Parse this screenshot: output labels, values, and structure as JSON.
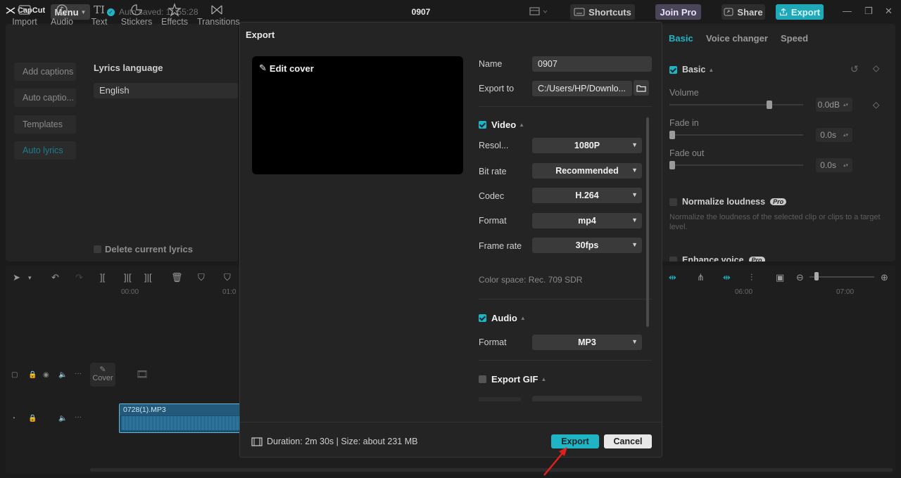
{
  "app": {
    "logo_text": "CapCut",
    "menu_label": "Menu",
    "autosave_text": "Auto saved: 11:55:28",
    "project_title": "0907",
    "shortcuts_label": "Shortcuts",
    "joinpro_label": "Join Pro",
    "share_label": "Share",
    "export_label": "Export"
  },
  "toolbar": {
    "items": [
      {
        "label": "Import",
        "icon": "import-icon"
      },
      {
        "label": "Audio",
        "icon": "audio-icon"
      },
      {
        "label": "Text",
        "icon": "text-icon"
      },
      {
        "label": "Stickers",
        "icon": "stickers-icon"
      },
      {
        "label": "Effects",
        "icon": "effects-icon"
      },
      {
        "label": "Transitions",
        "icon": "transitions-icon"
      }
    ]
  },
  "sidebar": {
    "items": [
      {
        "label": "Add captions"
      },
      {
        "label": "Auto captio..."
      },
      {
        "label": "Templates"
      },
      {
        "label": "Auto lyrics"
      }
    ]
  },
  "lyrics": {
    "heading": "Lyrics language",
    "language": "English",
    "delete_label": "Delete current lyrics"
  },
  "inspector": {
    "tabs": [
      {
        "label": "Basic"
      },
      {
        "label": "Voice changer"
      },
      {
        "label": "Speed"
      }
    ],
    "basic_label": "Basic",
    "volume_label": "Volume",
    "volume_value": "0.0dB",
    "fadein_label": "Fade in",
    "fadein_value": "0.0s",
    "fadeout_label": "Fade out",
    "fadeout_value": "0.0s",
    "normalize_label": "Normalize loudness",
    "normalize_desc": "Normalize the loudness of the selected clip or clips to a target level.",
    "enhance_label": "Enhance voice",
    "pro_badge": "Pro"
  },
  "timeline": {
    "ruler": [
      "00:00",
      "01:0",
      "06:00",
      "07:00"
    ],
    "cover_label": "Cover",
    "audio_clip_name": "0728(1).MP3"
  },
  "export_dialog": {
    "title": "Export",
    "edit_cover_label": "Edit cover",
    "name_label": "Name",
    "name_value": "0907",
    "export_to_label": "Export to",
    "export_to_value": "C:/Users/HP/Downlo...",
    "video_section": "Video",
    "resolution_label": "Resol...",
    "resolution_value": "1080P",
    "bitrate_label": "Bit rate",
    "bitrate_value": "Recommended",
    "codec_label": "Codec",
    "codec_value": "H.264",
    "format_label": "Format",
    "format_value": "mp4",
    "framerate_label": "Frame rate",
    "framerate_value": "30fps",
    "colorspace_text": "Color space: Rec. 709 SDR",
    "audio_section": "Audio",
    "audio_format_label": "Format",
    "audio_format_value": "MP3",
    "gif_section": "Export GIF",
    "footer_text": "Duration: 2m 30s | Size: about 231 MB",
    "export_button": "Export",
    "cancel_button": "Cancel"
  },
  "colors": {
    "accent": "#1fb5c5",
    "annotation_arrow": "#e0201c"
  }
}
